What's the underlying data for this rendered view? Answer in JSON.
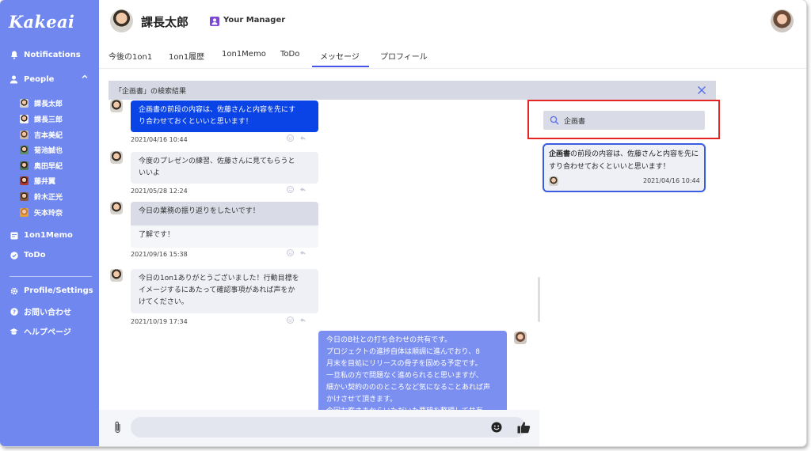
{
  "app": {
    "logo": "Kakeai"
  },
  "sidebar": {
    "notifications": "Notifications",
    "people": "People",
    "people_list": [
      "課長太郎",
      "課長三郎",
      "吉本美紀",
      "菊池誠也",
      "奥田早紀",
      "藤井翼",
      "鈴木正光",
      "矢本玲奈"
    ],
    "memo": "1on1Memo",
    "todo": "ToDo",
    "settings": "Profile/Settings",
    "contact": "お問い合わせ",
    "help": "ヘルプページ"
  },
  "header": {
    "name": "課長太郎",
    "role": "Your Manager"
  },
  "tabs": [
    "今後の1on1",
    "1on1履歴",
    "1on1Memo",
    "ToDo",
    "メッセージ",
    "プロフィール"
  ],
  "search_results": {
    "title": "「企画書」の検索結果",
    "query": "企画書",
    "result_highlight": "企画書",
    "result_rest": "の前段の内容は、佐藤さんと内容を先にすり合わせておくといいと思います！",
    "result_time": "2021/04/16 10:44"
  },
  "messages": [
    {
      "text": "企画書の前段の内容は、佐藤さんと内容を先にす\nり合わせておくといいと思います！",
      "time": "2021/04/16 10:44"
    },
    {
      "text": "今度のプレゼンの練習、佐藤さんに見てもらうと\nいいよ",
      "time": "2021/05/28 12:24"
    },
    {
      "text": "今日の業務の振り返りをしたいです！",
      "reply": "了解です！",
      "time": "2021/09/16 15:38"
    },
    {
      "text": "今日の1on1ありがとうございました！行動目標を\nイメージするにあたって確認事項があれば声をか\nけてください。",
      "time": "2021/10/19 17:34"
    },
    {
      "text": "今日のB社との打ち合わせの共有です。\nプロジェクトの進捗自体は順調に進んでおり、8\n月末を目処にリリースの骨子を固める予定です。\n一旦私の方で問題なく進められると思いますが、\n細かい契約のののところなど気になることあれば声\nかけさせて頂きます。\n今回お客さまからいただいた要望を整理して共有"
    }
  ],
  "input": {
    "placeholder": ""
  },
  "colors": {
    "sidebar": "#6f87ee",
    "accent": "#4654e5",
    "highlight": "#0a43e6",
    "red_box": "#e52424"
  },
  "icons": [
    "bell-icon",
    "person-icon",
    "chevron-up-icon",
    "memo-icon",
    "check-circle-icon",
    "gear-icon",
    "question-icon",
    "graduation-cap-icon",
    "close-icon",
    "search-icon",
    "paperclip-icon",
    "emoji-icon",
    "thumbs-up-icon",
    "reply-icon"
  ]
}
